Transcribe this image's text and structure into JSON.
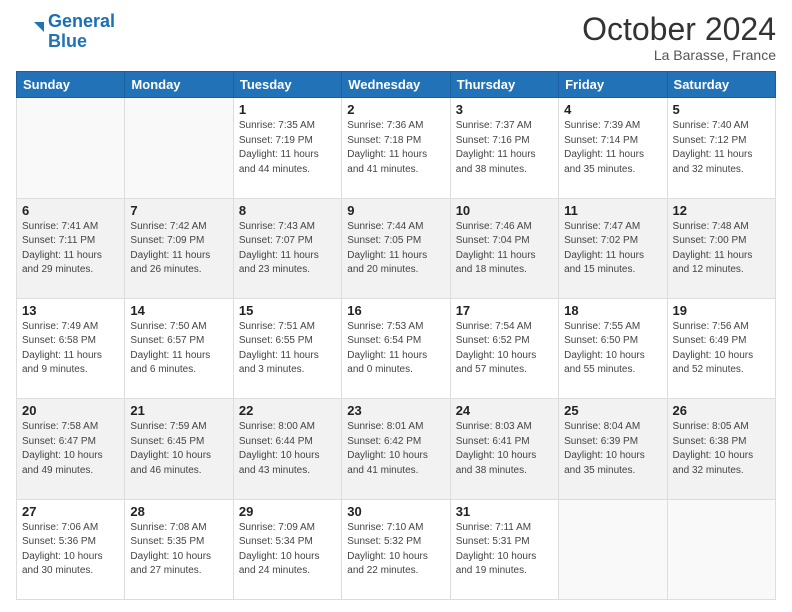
{
  "header": {
    "logo_line1": "General",
    "logo_line2": "Blue",
    "title": "October 2024",
    "subtitle": "La Barasse, France"
  },
  "days_of_week": [
    "Sunday",
    "Monday",
    "Tuesday",
    "Wednesday",
    "Thursday",
    "Friday",
    "Saturday"
  ],
  "weeks": [
    [
      {
        "day": "",
        "info": ""
      },
      {
        "day": "",
        "info": ""
      },
      {
        "day": "1",
        "info": "Sunrise: 7:35 AM\nSunset: 7:19 PM\nDaylight: 11 hours and 44 minutes."
      },
      {
        "day": "2",
        "info": "Sunrise: 7:36 AM\nSunset: 7:18 PM\nDaylight: 11 hours and 41 minutes."
      },
      {
        "day": "3",
        "info": "Sunrise: 7:37 AM\nSunset: 7:16 PM\nDaylight: 11 hours and 38 minutes."
      },
      {
        "day": "4",
        "info": "Sunrise: 7:39 AM\nSunset: 7:14 PM\nDaylight: 11 hours and 35 minutes."
      },
      {
        "day": "5",
        "info": "Sunrise: 7:40 AM\nSunset: 7:12 PM\nDaylight: 11 hours and 32 minutes."
      }
    ],
    [
      {
        "day": "6",
        "info": "Sunrise: 7:41 AM\nSunset: 7:11 PM\nDaylight: 11 hours and 29 minutes."
      },
      {
        "day": "7",
        "info": "Sunrise: 7:42 AM\nSunset: 7:09 PM\nDaylight: 11 hours and 26 minutes."
      },
      {
        "day": "8",
        "info": "Sunrise: 7:43 AM\nSunset: 7:07 PM\nDaylight: 11 hours and 23 minutes."
      },
      {
        "day": "9",
        "info": "Sunrise: 7:44 AM\nSunset: 7:05 PM\nDaylight: 11 hours and 20 minutes."
      },
      {
        "day": "10",
        "info": "Sunrise: 7:46 AM\nSunset: 7:04 PM\nDaylight: 11 hours and 18 minutes."
      },
      {
        "day": "11",
        "info": "Sunrise: 7:47 AM\nSunset: 7:02 PM\nDaylight: 11 hours and 15 minutes."
      },
      {
        "day": "12",
        "info": "Sunrise: 7:48 AM\nSunset: 7:00 PM\nDaylight: 11 hours and 12 minutes."
      }
    ],
    [
      {
        "day": "13",
        "info": "Sunrise: 7:49 AM\nSunset: 6:58 PM\nDaylight: 11 hours and 9 minutes."
      },
      {
        "day": "14",
        "info": "Sunrise: 7:50 AM\nSunset: 6:57 PM\nDaylight: 11 hours and 6 minutes."
      },
      {
        "day": "15",
        "info": "Sunrise: 7:51 AM\nSunset: 6:55 PM\nDaylight: 11 hours and 3 minutes."
      },
      {
        "day": "16",
        "info": "Sunrise: 7:53 AM\nSunset: 6:54 PM\nDaylight: 11 hours and 0 minutes."
      },
      {
        "day": "17",
        "info": "Sunrise: 7:54 AM\nSunset: 6:52 PM\nDaylight: 10 hours and 57 minutes."
      },
      {
        "day": "18",
        "info": "Sunrise: 7:55 AM\nSunset: 6:50 PM\nDaylight: 10 hours and 55 minutes."
      },
      {
        "day": "19",
        "info": "Sunrise: 7:56 AM\nSunset: 6:49 PM\nDaylight: 10 hours and 52 minutes."
      }
    ],
    [
      {
        "day": "20",
        "info": "Sunrise: 7:58 AM\nSunset: 6:47 PM\nDaylight: 10 hours and 49 minutes."
      },
      {
        "day": "21",
        "info": "Sunrise: 7:59 AM\nSunset: 6:45 PM\nDaylight: 10 hours and 46 minutes."
      },
      {
        "day": "22",
        "info": "Sunrise: 8:00 AM\nSunset: 6:44 PM\nDaylight: 10 hours and 43 minutes."
      },
      {
        "day": "23",
        "info": "Sunrise: 8:01 AM\nSunset: 6:42 PM\nDaylight: 10 hours and 41 minutes."
      },
      {
        "day": "24",
        "info": "Sunrise: 8:03 AM\nSunset: 6:41 PM\nDaylight: 10 hours and 38 minutes."
      },
      {
        "day": "25",
        "info": "Sunrise: 8:04 AM\nSunset: 6:39 PM\nDaylight: 10 hours and 35 minutes."
      },
      {
        "day": "26",
        "info": "Sunrise: 8:05 AM\nSunset: 6:38 PM\nDaylight: 10 hours and 32 minutes."
      }
    ],
    [
      {
        "day": "27",
        "info": "Sunrise: 7:06 AM\nSunset: 5:36 PM\nDaylight: 10 hours and 30 minutes."
      },
      {
        "day": "28",
        "info": "Sunrise: 7:08 AM\nSunset: 5:35 PM\nDaylight: 10 hours and 27 minutes."
      },
      {
        "day": "29",
        "info": "Sunrise: 7:09 AM\nSunset: 5:34 PM\nDaylight: 10 hours and 24 minutes."
      },
      {
        "day": "30",
        "info": "Sunrise: 7:10 AM\nSunset: 5:32 PM\nDaylight: 10 hours and 22 minutes."
      },
      {
        "day": "31",
        "info": "Sunrise: 7:11 AM\nSunset: 5:31 PM\nDaylight: 10 hours and 19 minutes."
      },
      {
        "day": "",
        "info": ""
      },
      {
        "day": "",
        "info": ""
      }
    ]
  ]
}
